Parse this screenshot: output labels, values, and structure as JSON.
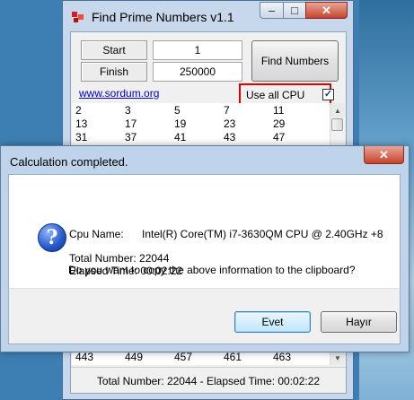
{
  "main_window": {
    "title": "Find Prime Numbers v1.1",
    "controls": {
      "minimize": "–",
      "maximize": "□",
      "close": "✕"
    },
    "start_label": "Start",
    "start_value": "1",
    "finish_label": "Finish",
    "finish_value": "250000",
    "find_button": "Find Numbers",
    "link": "www.sordum.org",
    "cpu_checkbox_label": "Use all CPU cores",
    "cpu_checked": "✓",
    "numbers_rows": [
      [
        "2",
        "3",
        "5",
        "7",
        "11"
      ],
      [
        "13",
        "17",
        "19",
        "23",
        "29"
      ],
      [
        "31",
        "37",
        "41",
        "43",
        "47"
      ]
    ],
    "bottom_numbers_row": [
      "443",
      "449",
      "457",
      "461",
      "463"
    ],
    "status_bar": "Total Number: 22044  -  Elapsed Time: 00:02:22"
  },
  "dialog": {
    "title": "Calculation completed.",
    "close": "✕",
    "icon": "info-question-icon",
    "cpu_label": "Cpu Name:",
    "cpu_value": "Intel(R) Core(TM) i7-3630QM CPU @ 2.40GHz +8",
    "total_number": "Total Number: 22044",
    "elapsed_time": "Elapsed Time: 00:02:22",
    "question": "Do you want to copy the above information to the clipboard?",
    "yes_button": "Evet",
    "no_button": "Hayır"
  }
}
